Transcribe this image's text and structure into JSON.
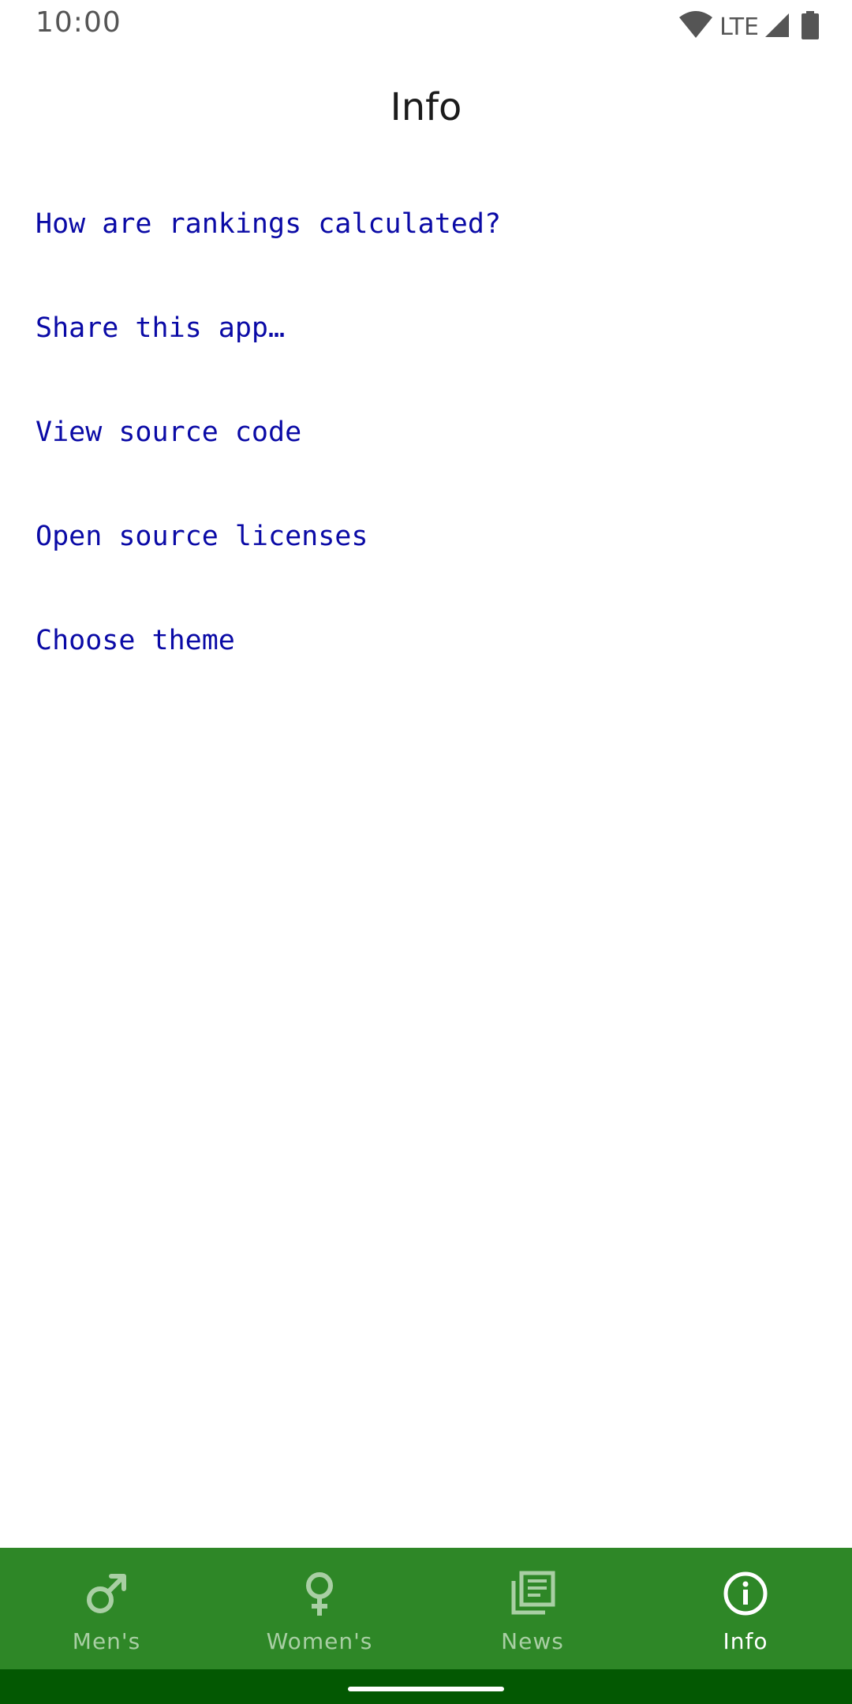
{
  "status_bar": {
    "time": "10:00",
    "network": "LTE",
    "icons": [
      "wifi-icon",
      "cell-signal-icon",
      "battery-icon"
    ]
  },
  "header": {
    "title": "Info"
  },
  "menu": {
    "items": [
      {
        "label": "How are rankings calculated?"
      },
      {
        "label": "Share this app…"
      },
      {
        "label": "View source code"
      },
      {
        "label": "Open source licenses"
      },
      {
        "label": "Choose theme"
      }
    ]
  },
  "bottom_nav": {
    "items": [
      {
        "label": "Men's",
        "icon": "male-symbol-icon",
        "active": false
      },
      {
        "label": "Women's",
        "icon": "female-symbol-icon",
        "active": false
      },
      {
        "label": "News",
        "icon": "newspaper-icon",
        "active": false
      },
      {
        "label": "Info",
        "icon": "info-icon",
        "active": true
      }
    ]
  },
  "colors": {
    "link": "#0a0aa6",
    "nav_background": "#2e8727",
    "nav_inactive": "#a9cfa4",
    "nav_active": "#ffffff",
    "system_nav_background": "#035802"
  }
}
